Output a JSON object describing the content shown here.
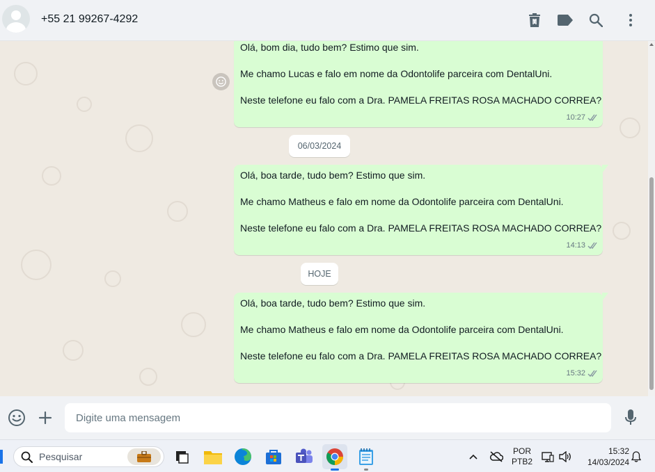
{
  "header": {
    "contact_name": "+55 21 99267-4292",
    "icons": [
      "delete-icon",
      "label-icon",
      "search-icon",
      "menu-icon"
    ]
  },
  "messages": [
    {
      "lines": [
        "Olá, bom dia, tudo bem? Estimo que sim.",
        "Me chamo Lucas e falo em nome da Odontolife parceira com DentalUni.",
        "Neste telefone eu falo com a Dra. PAMELA FREITAS ROSA MACHADO CORREA?"
      ],
      "time": "10:27",
      "status": "read"
    },
    {
      "lines": [
        "Olá, boa tarde, tudo bem? Estimo que sim.",
        "Me chamo Matheus e falo em nome da Odontolife parceira com DentalUni.",
        "Neste telefone eu falo com a Dra. PAMELA FREITAS ROSA MACHADO CORREA?"
      ],
      "time": "14:13",
      "status": "read"
    },
    {
      "lines": [
        "Olá, boa tarde, tudo bem? Estimo que sim.",
        "Me chamo Matheus e falo em nome da Odontolife parceira com DentalUni.",
        "Neste telefone eu falo com a Dra. PAMELA FREITAS ROSA MACHADO CORREA?"
      ],
      "time": "15:32",
      "status": "read"
    }
  ],
  "date_separators": [
    "06/03/2024",
    "HOJE"
  ],
  "composer": {
    "placeholder": "Digite uma mensagem",
    "value": ""
  },
  "taskbar": {
    "search_label": "Pesquisar",
    "apps": [
      "task-view",
      "file-explorer",
      "edge",
      "microsoft-store",
      "teams",
      "chrome",
      "notepad"
    ],
    "active_app": "chrome",
    "language": "POR",
    "keyboard": "PTB2",
    "time": "15:32",
    "date": "14/03/2024"
  },
  "colors": {
    "outgoing_bubble": "#d9fdd3",
    "chat_background": "#efeae2",
    "header_background": "#f0f2f5",
    "read_ticks": "#8696a0"
  }
}
